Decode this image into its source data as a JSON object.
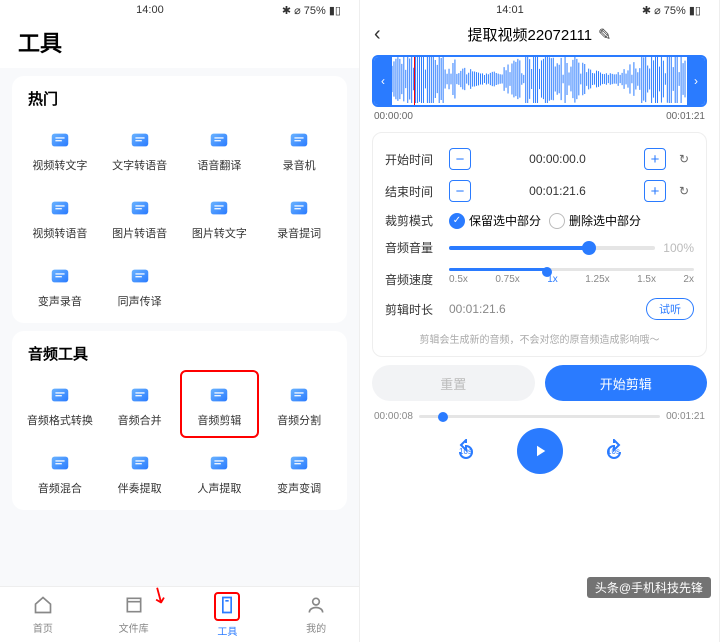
{
  "left": {
    "status": {
      "time": "14:00",
      "right": "✱ ⌀ 75% ▮▯"
    },
    "title": "工具",
    "sections": [
      {
        "title": "热门",
        "tools": [
          {
            "label": "视频转文字",
            "icon": "video-text"
          },
          {
            "label": "文字转语音",
            "icon": "text-voice"
          },
          {
            "label": "语音翻译",
            "icon": "translate"
          },
          {
            "label": "录音机",
            "icon": "recorder"
          },
          {
            "label": "视频转语音",
            "icon": "video-voice"
          },
          {
            "label": "图片转语音",
            "icon": "img-voice"
          },
          {
            "label": "图片转文字",
            "icon": "img-text"
          },
          {
            "label": "录音提词",
            "icon": "record-teleprompt"
          },
          {
            "label": "变声录音",
            "icon": "voice-change"
          },
          {
            "label": "同声传译",
            "icon": "interpret"
          }
        ]
      },
      {
        "title": "音频工具",
        "tools": [
          {
            "label": "音频格式转换",
            "icon": "audio-convert"
          },
          {
            "label": "音频合并",
            "icon": "audio-merge"
          },
          {
            "label": "音频剪辑",
            "icon": "audio-trim",
            "highlight": true
          },
          {
            "label": "音频分割",
            "icon": "audio-split"
          },
          {
            "label": "音频混合",
            "icon": "audio-mix"
          },
          {
            "label": "伴奏提取",
            "icon": "extract-accomp"
          },
          {
            "label": "人声提取",
            "icon": "extract-vocal"
          },
          {
            "label": "变声变调",
            "icon": "pitch-shift"
          }
        ]
      }
    ],
    "tabs": [
      {
        "label": "首页"
      },
      {
        "label": "文件库"
      },
      {
        "label": "工具",
        "active": true
      },
      {
        "label": "我的"
      }
    ]
  },
  "right": {
    "status": {
      "time": "14:01",
      "right": "✱ ⌀ 75% ▮▯"
    },
    "title": "提取视频22072111",
    "wave": {
      "start": "00:00:00",
      "end": "00:01:21"
    },
    "start_time": {
      "label": "开始时间",
      "value": "00:00:00.0"
    },
    "end_time": {
      "label": "结束时间",
      "value": "00:01:21.6"
    },
    "mode": {
      "label": "裁剪模式",
      "keep": "保留选中部分",
      "remove": "删除选中部分"
    },
    "volume": {
      "label": "音频音量",
      "max": "100%",
      "pct": 68
    },
    "speed": {
      "label": "音频速度",
      "opts": [
        "0.5x",
        "0.75x",
        "1x",
        "1.25x",
        "1.5x",
        "2x"
      ],
      "active": 2
    },
    "duration": {
      "label": "剪辑时长",
      "value": "00:01:21.6",
      "try": "试听"
    },
    "notice": "剪辑会生成新的音频，不会对您的原音频造成影响哦～",
    "reset": "重置",
    "start": "开始剪辑",
    "play": {
      "pos": "00:00:08",
      "total": "00:01:21",
      "seek": "10s"
    },
    "watermark": "头条@手机科技先锋"
  }
}
